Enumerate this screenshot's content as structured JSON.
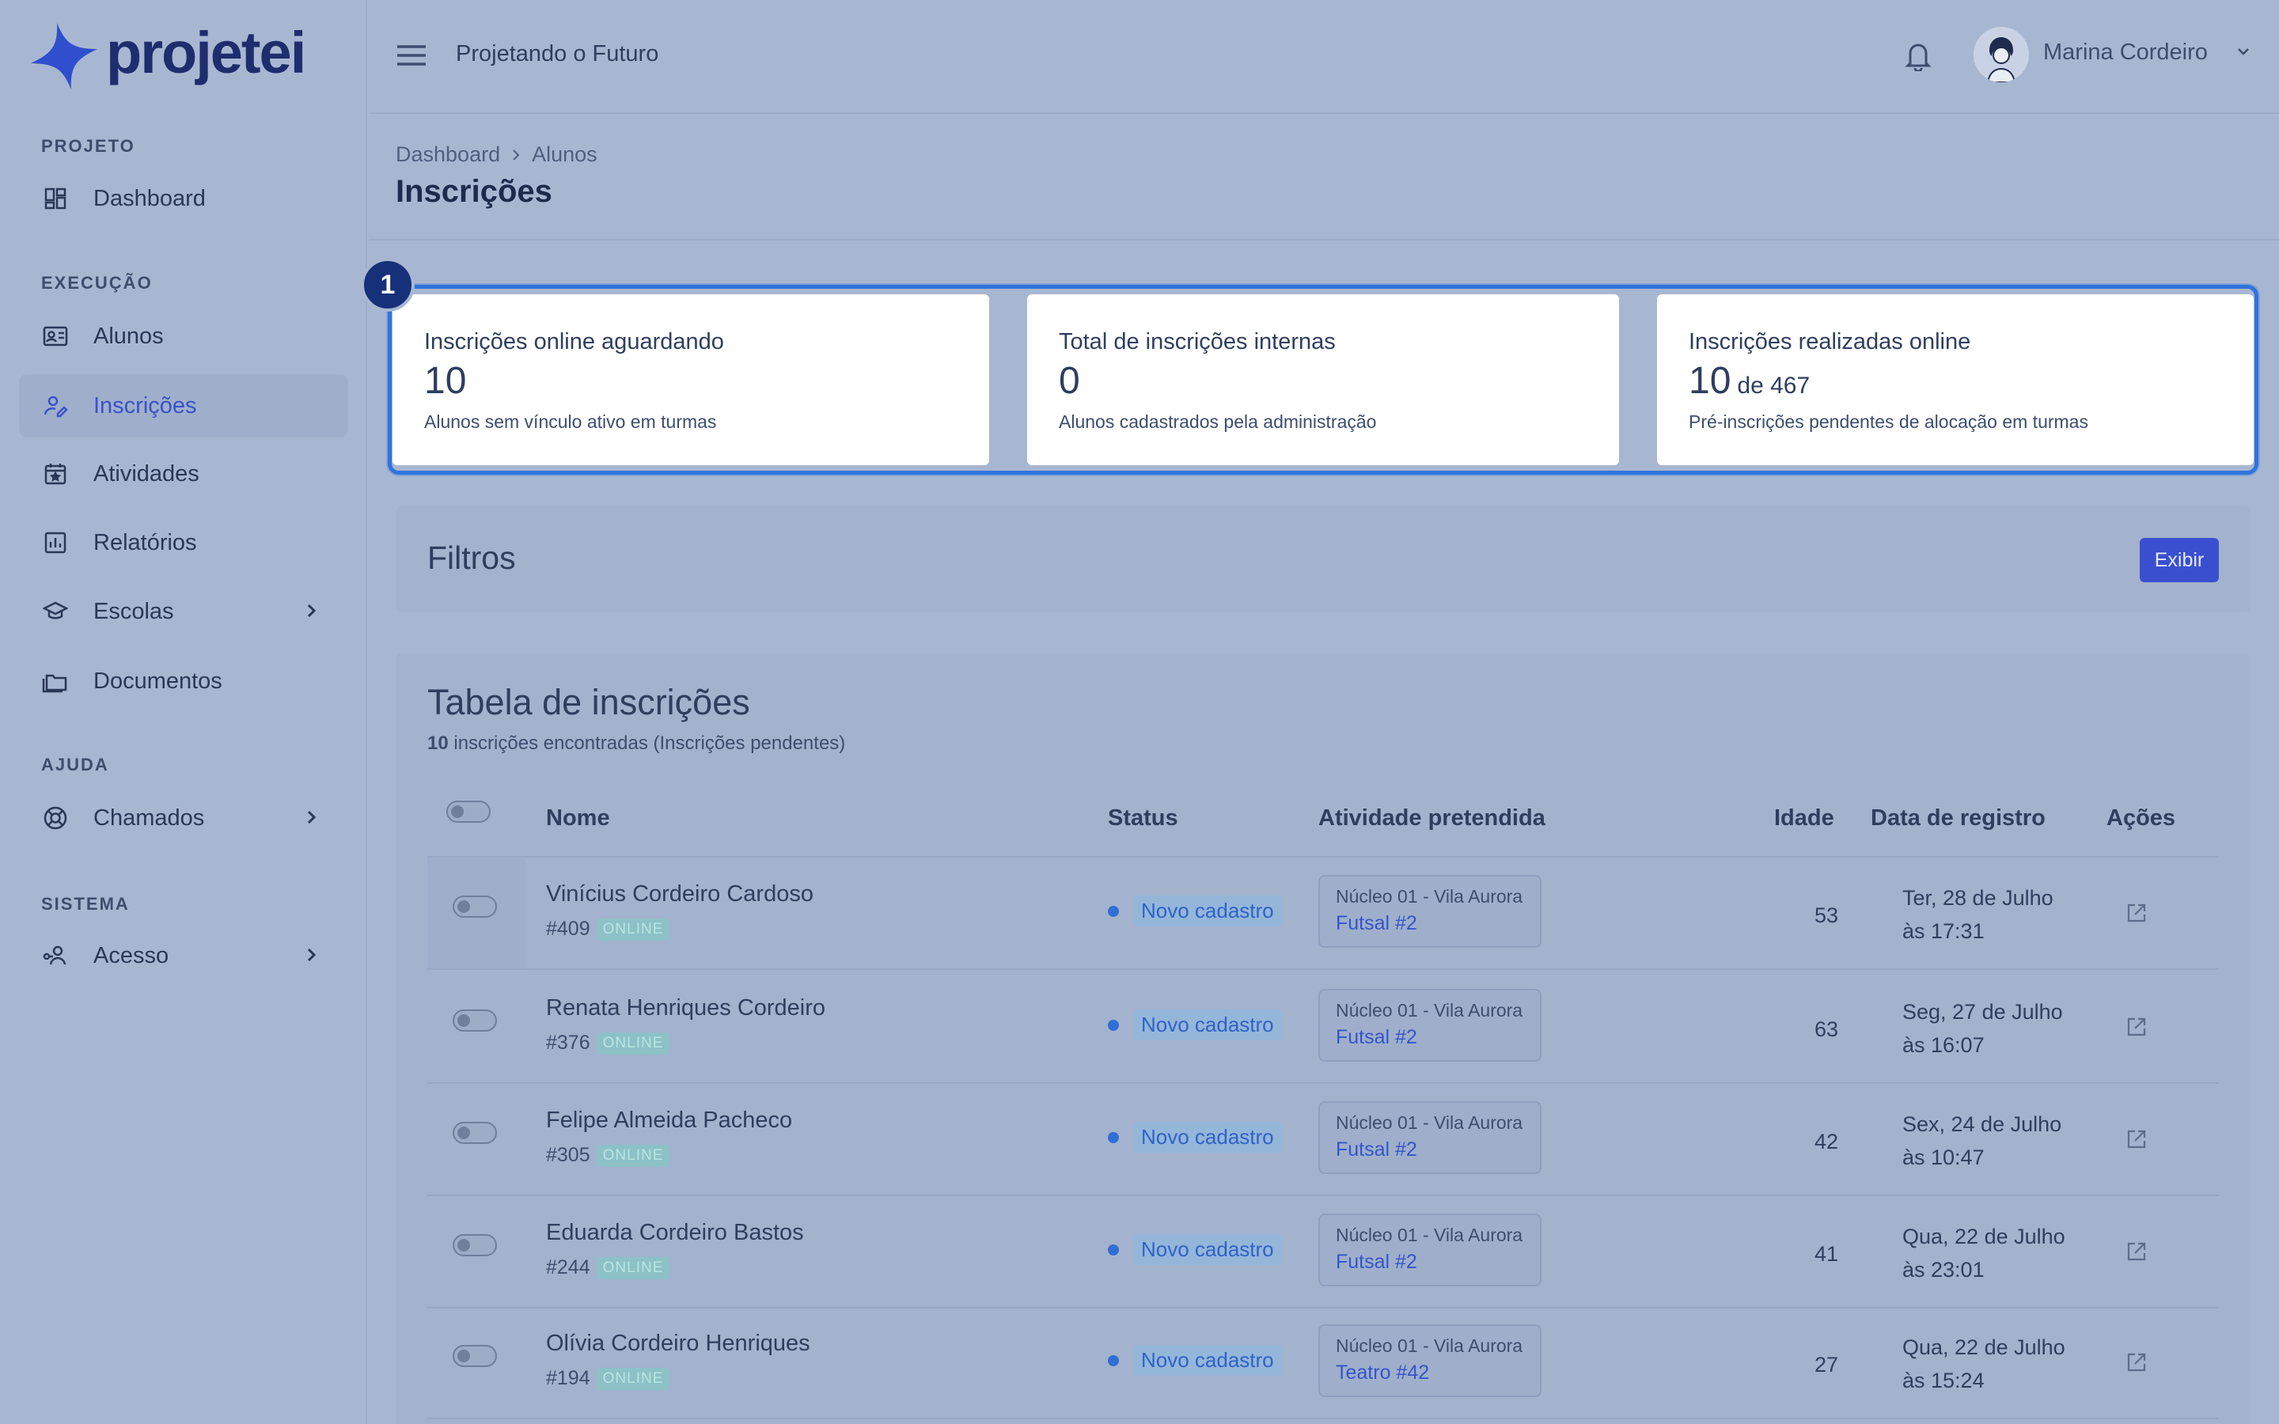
{
  "brand": {
    "name": "projetei",
    "logo_color": "#2f4fcf"
  },
  "sidebar": {
    "sections": [
      {
        "label": "PROJETO",
        "items": [
          {
            "label": "Dashboard",
            "icon": "dashboard-grid-icon"
          }
        ]
      },
      {
        "label": "EXECUÇÃO",
        "items": [
          {
            "label": "Alunos",
            "icon": "id-card-icon"
          },
          {
            "label": "Inscrições",
            "icon": "user-edit-icon",
            "active": true
          },
          {
            "label": "Atividades",
            "icon": "calendar-icon"
          },
          {
            "label": "Relatórios",
            "icon": "bar-chart-icon"
          },
          {
            "label": "Escolas",
            "icon": "graduation-cap-icon",
            "has_submenu": true
          },
          {
            "label": "Documentos",
            "icon": "folders-icon"
          }
        ]
      },
      {
        "label": "AJUDA",
        "items": [
          {
            "label": "Chamados",
            "icon": "lifebuoy-icon",
            "has_submenu": true
          }
        ]
      },
      {
        "label": "SISTEMA",
        "items": [
          {
            "label": "Acesso",
            "icon": "user-key-icon",
            "has_submenu": true
          }
        ]
      }
    ]
  },
  "header": {
    "project_name": "Projetando o Futuro",
    "user_name": "Marina Cordeiro"
  },
  "page": {
    "breadcrumb": [
      "Dashboard",
      "Alunos"
    ],
    "title": "Inscrições"
  },
  "highlight_badge": "1",
  "stats": [
    {
      "label": "Inscrições online aguardando",
      "value": "10",
      "value_sub": "",
      "desc": "Alunos sem vínculo ativo em turmas"
    },
    {
      "label": "Total de inscrições internas",
      "value": "0",
      "value_sub": "",
      "desc": "Alunos cadastrados pela administração"
    },
    {
      "label": "Inscrições realizadas online",
      "value": "10",
      "value_sub": "de 467",
      "desc": "Pré-inscrições pendentes de alocação em turmas"
    }
  ],
  "filters": {
    "title": "Filtros",
    "button_label": "Exibir"
  },
  "table": {
    "title": "Tabela de inscrições",
    "count": "10",
    "count_suffix": " inscrições encontradas (Inscrições pendentes)",
    "columns": {
      "name": "Nome",
      "status": "Status",
      "activity": "Atividade pretendida",
      "age": "Idade",
      "date": "Data de registro",
      "actions": "Ações"
    },
    "rows": [
      {
        "name": "Vinícius Cordeiro Cardoso",
        "id": "#409",
        "tag": "ONLINE",
        "status": "Novo cadastro",
        "nucleo": "Núcleo 01 - Vila Aurora",
        "turma": "Futsal #2",
        "age": "53",
        "date_line1": "Ter, 28 de Julho",
        "date_line2": "às 17:31"
      },
      {
        "name": "Renata Henriques Cordeiro",
        "id": "#376",
        "tag": "ONLINE",
        "status": "Novo cadastro",
        "nucleo": "Núcleo 01 - Vila Aurora",
        "turma": "Futsal #2",
        "age": "63",
        "date_line1": "Seg, 27 de Julho",
        "date_line2": "às 16:07"
      },
      {
        "name": "Felipe Almeida Pacheco",
        "id": "#305",
        "tag": "ONLINE",
        "status": "Novo cadastro",
        "nucleo": "Núcleo 01 - Vila Aurora",
        "turma": "Futsal #2",
        "age": "42",
        "date_line1": "Sex, 24 de Julho",
        "date_line2": "às 10:47"
      },
      {
        "name": "Eduarda Cordeiro Bastos",
        "id": "#244",
        "tag": "ONLINE",
        "status": "Novo cadastro",
        "nucleo": "Núcleo 01 - Vila Aurora",
        "turma": "Futsal #2",
        "age": "41",
        "date_line1": "Qua, 22 de Julho",
        "date_line2": "às 23:01"
      },
      {
        "name": "Olívia Cordeiro Henriques",
        "id": "#194",
        "tag": "ONLINE",
        "status": "Novo cadastro",
        "nucleo": "Núcleo 01 - Vila Aurora",
        "turma": "Teatro #42",
        "age": "27",
        "date_line1": "Qua, 22 de Julho",
        "date_line2": "às 15:24"
      }
    ]
  }
}
